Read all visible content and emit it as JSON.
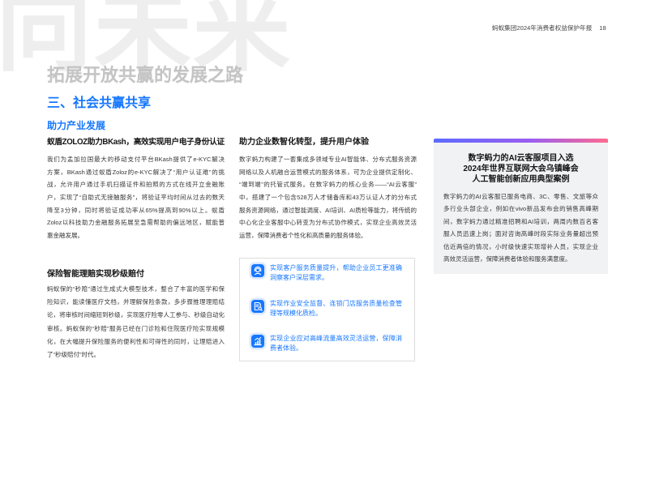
{
  "watermark": "向未来",
  "header": {
    "report_title": "蚂蚁集团2024年消费者权益保护年报",
    "page_number": "18"
  },
  "chapter_title": "拓展开放共赢的发展之路",
  "section_title": "三、社会共赢共享",
  "subsection_title": "助力产业发展",
  "left_column": {
    "case_bkash": {
      "heading": "蚁盾ZOLOZ助力BKash，高效实现用户电子身份认证",
      "lines": [
        "我们为孟加拉国最大的移动支付平台BKash提供了e-KYC解决",
        "方案，BKash通过蚁盾Zoloz的e-KYC解决了“用户认证难”的挑",
        "战，允许用户通过手机扫描证件和拍照的方式在线开立金融账",
        "户，实现了“自助式无接触服务”，将验证平均时间从过去的数天",
        "降至3分钟，同时将验证成功率从65%提高到90%以上。蚁盾",
        "Zoloz以科技助力金融服务拓展至急需帮助的偏远地区，赋能普",
        "惠金融发展。"
      ]
    },
    "case_insurance": {
      "heading": "保险智能理赔实现秒级赔付",
      "lines": [
        "蚂蚁保的“秒赔”通过生成式大模型技术，整合了丰富的医学和保",
        "险知识，能读懂医疗文档，并理解保险条款，多步骤推理理赔结",
        "论，将审核时间缩短到秒级，实现医疗险零人工参与、秒级自动化",
        "审核。蚂蚁保的“秒赔”服务已经在门诊险和住院医疗险实现规模",
        "化，在大幅提升保险服务的便利性和可得性的同时，让理赔进入",
        "了“秒级赔付”时代。"
      ]
    }
  },
  "middle_column": {
    "heading": "助力企业数智化转型，提升用户体验",
    "lines": [
      "数字蚂力构建了一套集成多领域专业AI智能体、分布式服务资源",
      "网络以及人机融合运营模式的服务体系，可为企业提供定制化、",
      "“端到端”的托管式服务。在数字蚂力的核心业务——“AI云客服”",
      "中，搭建了一个包含528万人才储备库和43万认证人才的分布式",
      "服务资源网络，通过智能调度、AI培训、AI质检等能力，将传统的",
      "中心化企业客服中心转变为分布式协作模式，实现企业高效灵活",
      "运营，保障消费者个性化和高质量的服务体验。"
    ],
    "highlights": [
      {
        "icon": "customer-service-icon",
        "lines": [
          "实现客户服务质量提升，帮助企业员工更准确",
          "洞察客户深层需求。"
        ]
      },
      {
        "icon": "quality-inspection-icon",
        "lines": [
          "实现作业安全监督、连锁门店服务质量检查管",
          "理等规模化质检。"
        ]
      },
      {
        "icon": "flexible-operations-icon",
        "lines": [
          "实现企业应对高峰流量高效灵活运营，保障消",
          "费者体验。"
        ]
      }
    ]
  },
  "right_panel": {
    "title_lines": [
      "数字蚂力的AI云客服项目入选",
      "2024年世界互联网大会乌镇峰会",
      "人工智能创新应用典型案例"
    ],
    "lines": [
      "数字蚂力的AI云客服已服务电商、3C、零售、文旅等众",
      "多行业头部企业，例如在vivo新品发布会的销售高峰期",
      "间，数字蚂力通过精准招聘和AI培训，两周内数百名客",
      "服人员迅速上岗；面对咨询高峰时段实际业务量超出预",
      "估近两倍的情况，小时级快速实现增补人员，实现企业",
      "高效灵活运营，保障消费者体验和服务满意度。"
    ]
  },
  "colors": {
    "accent": "#1677ff",
    "body_text": "#383838",
    "heading_text": "#141414",
    "watermark": "#eeeeee",
    "chapter_title": "#c4c4c4",
    "panel_background": "#f1f2f4",
    "box_border": "#dedede",
    "header_text": "#454545",
    "icon_halo": "#dbe8ff",
    "gradient_start": "#5d6bff",
    "gradient_mid": "#9a5ef0",
    "gradient_end": "#ff6a8e"
  }
}
